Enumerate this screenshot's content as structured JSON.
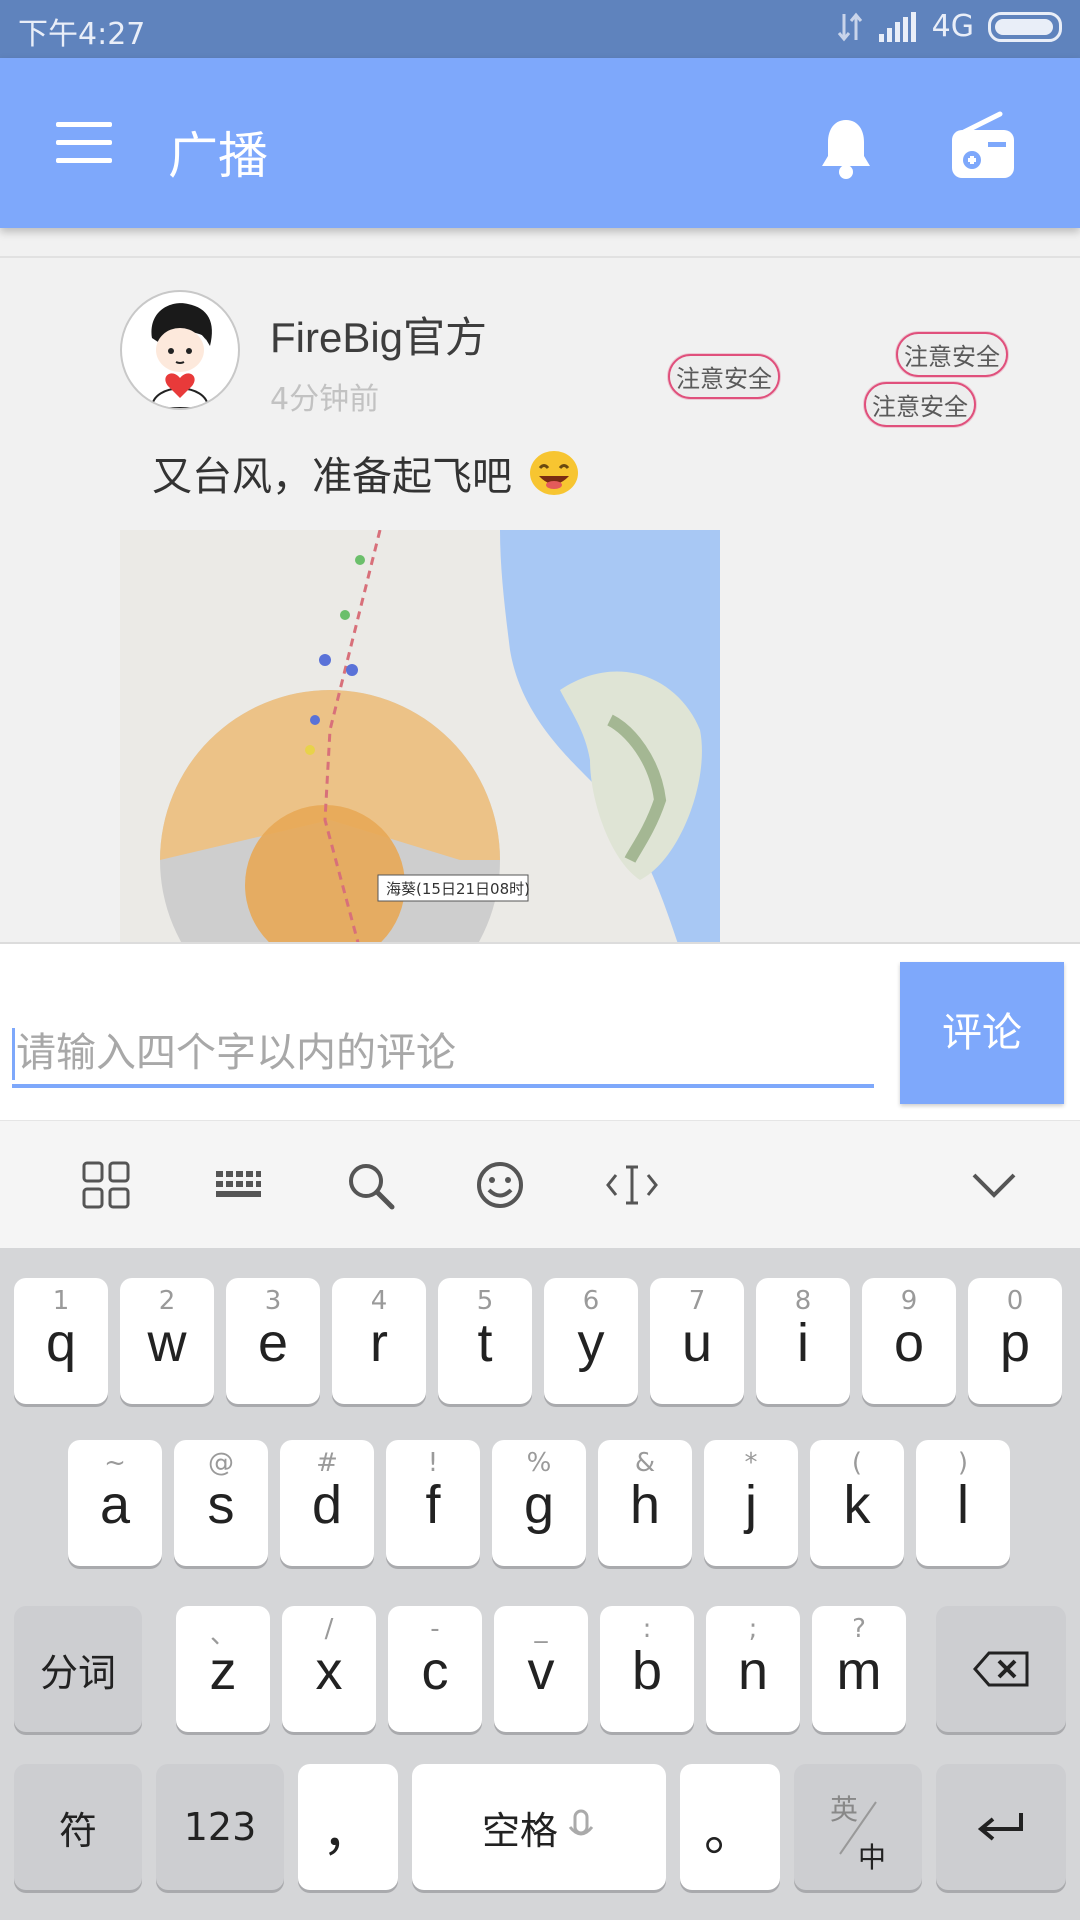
{
  "status_bar": {
    "time": "下午4:27",
    "network": "4G"
  },
  "app_bar": {
    "title": "广播"
  },
  "post": {
    "author": "FireBig官方",
    "time_ago": "4分钟前",
    "text": "又台风，准备起飞吧",
    "tags": [
      "注意安全",
      "注意安全",
      "注意安全"
    ],
    "image_label": "海葵(15日21日08时)"
  },
  "composer": {
    "placeholder": "请输入四个字以内的评论",
    "submit_label": "评论"
  },
  "keyboard": {
    "row1": [
      {
        "hint": "1",
        "key": "q"
      },
      {
        "hint": "2",
        "key": "w"
      },
      {
        "hint": "3",
        "key": "e"
      },
      {
        "hint": "4",
        "key": "r"
      },
      {
        "hint": "5",
        "key": "t"
      },
      {
        "hint": "6",
        "key": "y"
      },
      {
        "hint": "7",
        "key": "u"
      },
      {
        "hint": "8",
        "key": "i"
      },
      {
        "hint": "9",
        "key": "o"
      },
      {
        "hint": "0",
        "key": "p"
      }
    ],
    "row2": [
      {
        "hint": "~",
        "key": "a"
      },
      {
        "hint": "@",
        "key": "s"
      },
      {
        "hint": "#",
        "key": "d"
      },
      {
        "hint": "!",
        "key": "f"
      },
      {
        "hint": "%",
        "key": "g"
      },
      {
        "hint": "&",
        "key": "h"
      },
      {
        "hint": "*",
        "key": "j"
      },
      {
        "hint": "(",
        "key": "k"
      },
      {
        "hint": ")",
        "key": "l"
      }
    ],
    "row3": [
      {
        "hint": "、",
        "key": "z"
      },
      {
        "hint": "/",
        "key": "x"
      },
      {
        "hint": "-",
        "key": "c"
      },
      {
        "hint": "_",
        "key": "v"
      },
      {
        "hint": ":",
        "key": "b"
      },
      {
        "hint": ";",
        "key": "n"
      },
      {
        "hint": "?",
        "key": "m"
      }
    ],
    "segment_label": "分词",
    "symbols_label": "符",
    "numbers_label": "123",
    "comma_label": "，",
    "space_label": "空格",
    "period_label": "。",
    "lang_top": "英",
    "lang_bottom": "中"
  }
}
